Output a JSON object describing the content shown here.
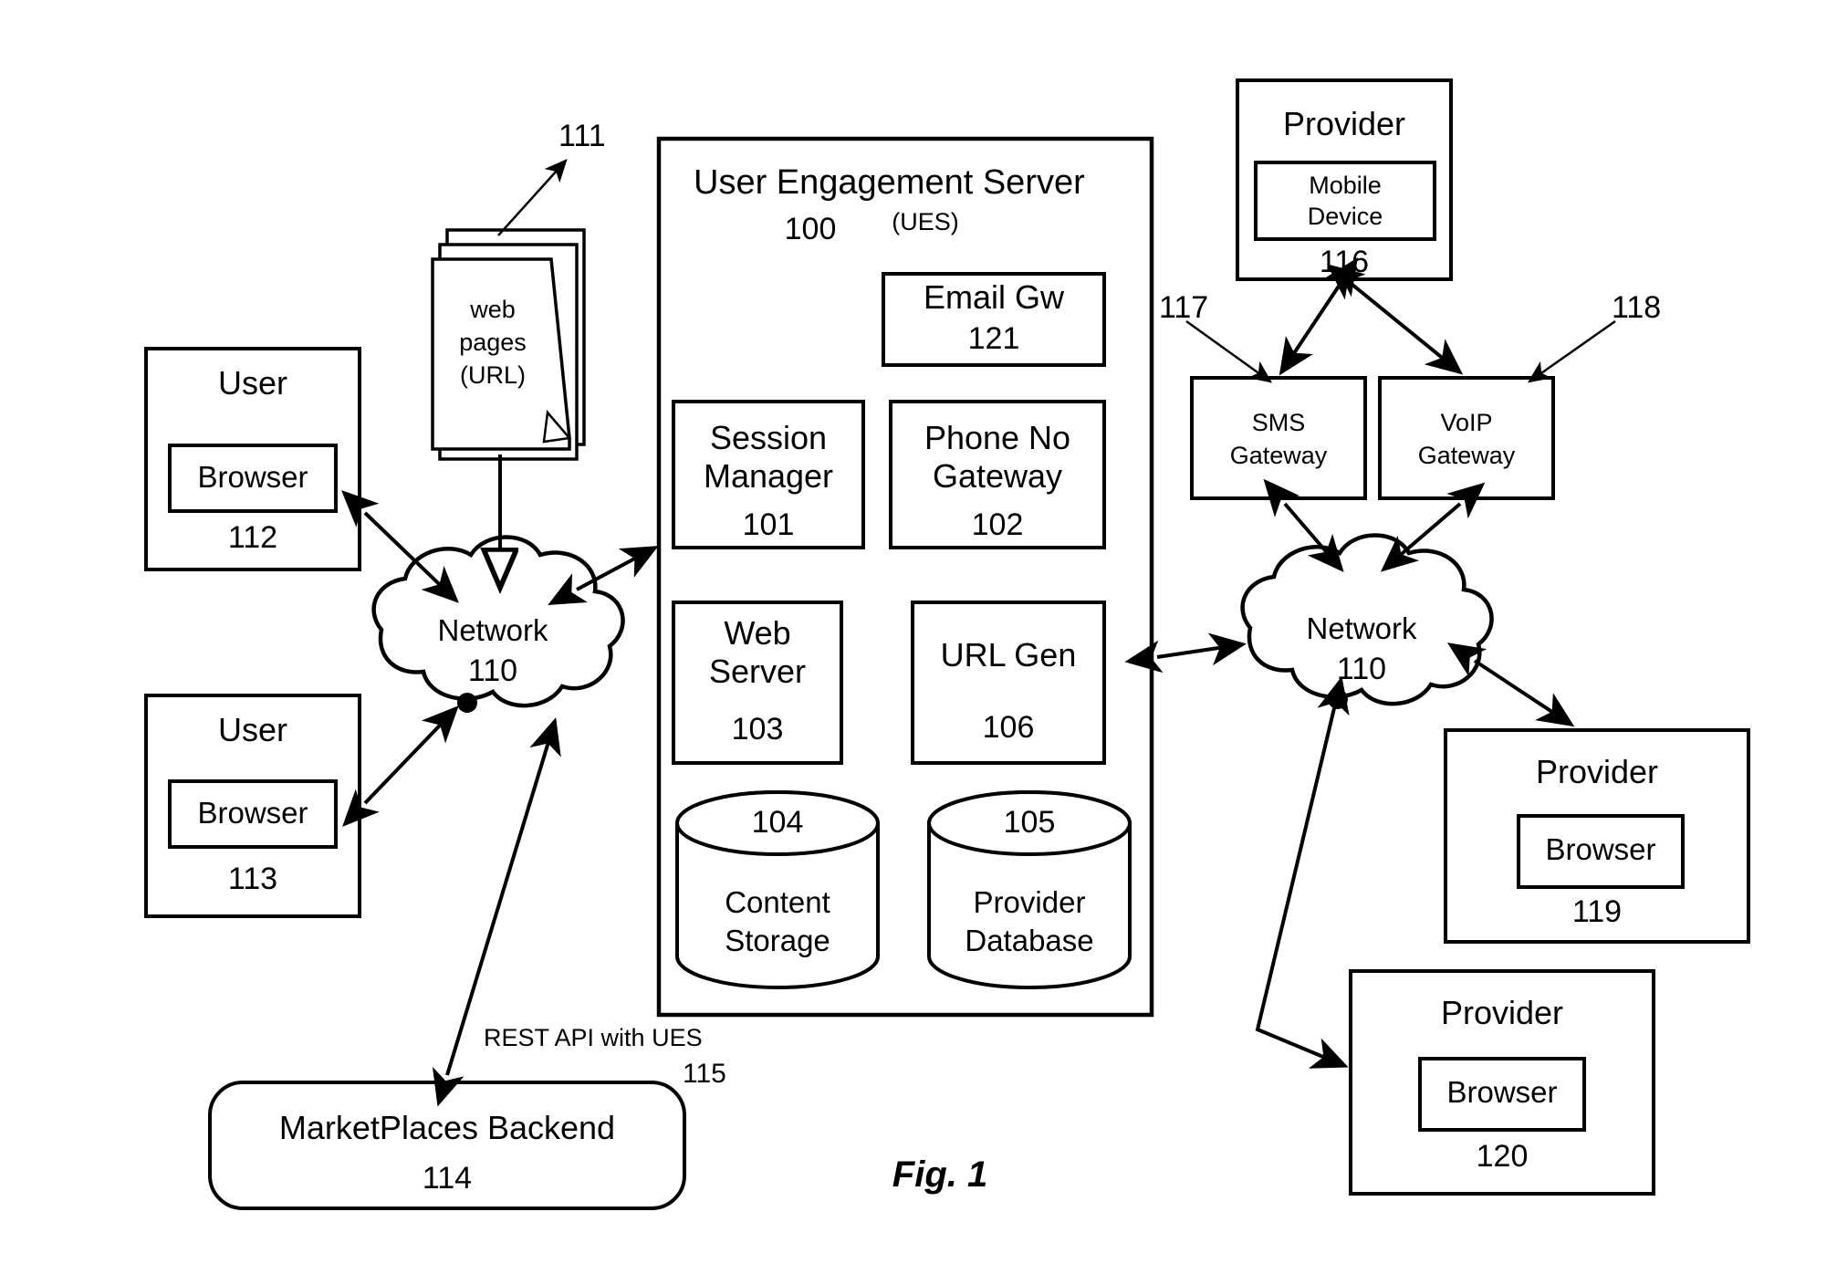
{
  "figure": {
    "caption": "Fig. 1"
  },
  "ues": {
    "title": "User Engagement Server",
    "ref": "100",
    "abbrev": "(UES)",
    "modules": [
      {
        "name": "email_gw",
        "label_line1": "Email Gw",
        "label_line2": "",
        "ref": "121"
      },
      {
        "name": "session_manager",
        "label_line1": "Session",
        "label_line2": "Manager",
        "ref": "101"
      },
      {
        "name": "phone_no_gateway",
        "label_line1": "Phone No",
        "label_line2": "Gateway",
        "ref": "102"
      },
      {
        "name": "web_server",
        "label_line1": "Web",
        "label_line2": "Server",
        "ref": "103"
      },
      {
        "name": "url_gen",
        "label_line1": "URL Gen",
        "label_line2": "",
        "ref": "106"
      }
    ],
    "stores": [
      {
        "name": "content_storage",
        "ref": "104",
        "label_line1": "Content",
        "label_line2": "Storage"
      },
      {
        "name": "provider_database",
        "ref": "105",
        "label_line1": "Provider",
        "label_line2": "Database"
      }
    ]
  },
  "web_pages": {
    "ref": "111",
    "line1": "web",
    "line2": "pages",
    "line3": "(URL)"
  },
  "users": [
    {
      "name": "user-112",
      "title": "User",
      "inner": "Browser",
      "ref": "112"
    },
    {
      "name": "user-113",
      "title": "User",
      "inner": "Browser",
      "ref": "113"
    }
  ],
  "networks": [
    {
      "name": "network-left",
      "label": "Network",
      "ref": "110"
    },
    {
      "name": "network-right",
      "label": "Network",
      "ref": "110"
    }
  ],
  "marketplaces": {
    "label": "MarketPlaces Backend",
    "ref": "114"
  },
  "rest_api": {
    "label": "REST API with UES",
    "ref": "115"
  },
  "provider_mobile": {
    "title": "Provider",
    "inner_line1": "Mobile",
    "inner_line2": "Device",
    "ref": "116"
  },
  "gateways": [
    {
      "name": "sms-gateway",
      "line1": "SMS",
      "line2": "Gateway",
      "ref": "117"
    },
    {
      "name": "voip-gateway",
      "line1": "VoIP",
      "line2": "Gateway",
      "ref": "118"
    }
  ],
  "providers": [
    {
      "name": "provider-119",
      "title": "Provider",
      "inner": "Browser",
      "ref": "119"
    },
    {
      "name": "provider-120",
      "title": "Provider",
      "inner": "Browser",
      "ref": "120"
    }
  ],
  "colors": {
    "stroke": "#000000",
    "fill": "#ffffff"
  }
}
